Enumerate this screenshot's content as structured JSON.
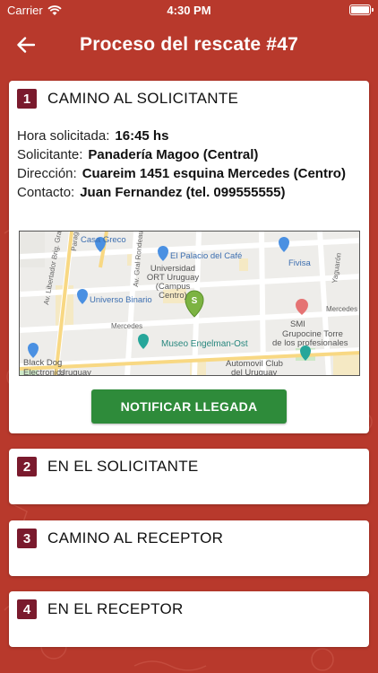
{
  "status_bar": {
    "carrier": "Carrier",
    "time": "4:30 PM",
    "icons": [
      "wifi-icon",
      "battery-icon"
    ]
  },
  "nav": {
    "title": "Proceso del rescate #47",
    "back_icon": "arrow-left-icon"
  },
  "colors": {
    "background": "#b8392c",
    "badge": "#7a1a2d",
    "button": "#2e8b3a"
  },
  "steps": [
    {
      "number": "1",
      "title": "CAMINO AL SOLICITANTE",
      "details": [
        {
          "label": "Hora solicitada:",
          "value": "16:45 hs"
        },
        {
          "label": "Solicitante:",
          "value": "Panadería Magoo (Central)"
        },
        {
          "label": "Dirección:",
          "value": "Cuareim 1451 esquina Mercedes (Centro)"
        },
        {
          "label": "Contacto:",
          "value": "Juan Fernandez (tel. 099555555)"
        }
      ],
      "map": {
        "marker_letter": "S",
        "labels": {
          "casa_greco": "Casa Greco",
          "palacio_cafe": "El Palacio del Café",
          "universidad_1": "Universidad",
          "universidad_2": "ORT Uruguay",
          "universidad_3": "(Campus",
          "universidad_4": "Centro)",
          "fivisa": "Fivisa",
          "universo_binario": "Universo Binario",
          "mercedes_1": "Mercedes",
          "mercedes_2": "Mercedes",
          "smi": "SMI",
          "grupocine_1": "Grupocine Torre",
          "grupocine_2": "de los profesionales",
          "museo": "Museo Engelman-Ost",
          "automovil_1": "Automovil Club",
          "automovil_2": "del Uruguay",
          "black_dog_1": "Black Dog",
          "black_dog_2": "Electronics",
          "uruguay": "Uruguay",
          "av_libertador": "Av. Libertador Brig. Gral.",
          "av_rondeau": "Av. Gral Rondeau",
          "yaguaron": "Yaguarón",
          "paraguay": "Paraguay"
        }
      },
      "button_label": "NOTIFICAR LLEGADA"
    },
    {
      "number": "2",
      "title": "EN EL SOLICITANTE"
    },
    {
      "number": "3",
      "title": "CAMINO AL RECEPTOR"
    },
    {
      "number": "4",
      "title": "EN EL RECEPTOR"
    }
  ]
}
